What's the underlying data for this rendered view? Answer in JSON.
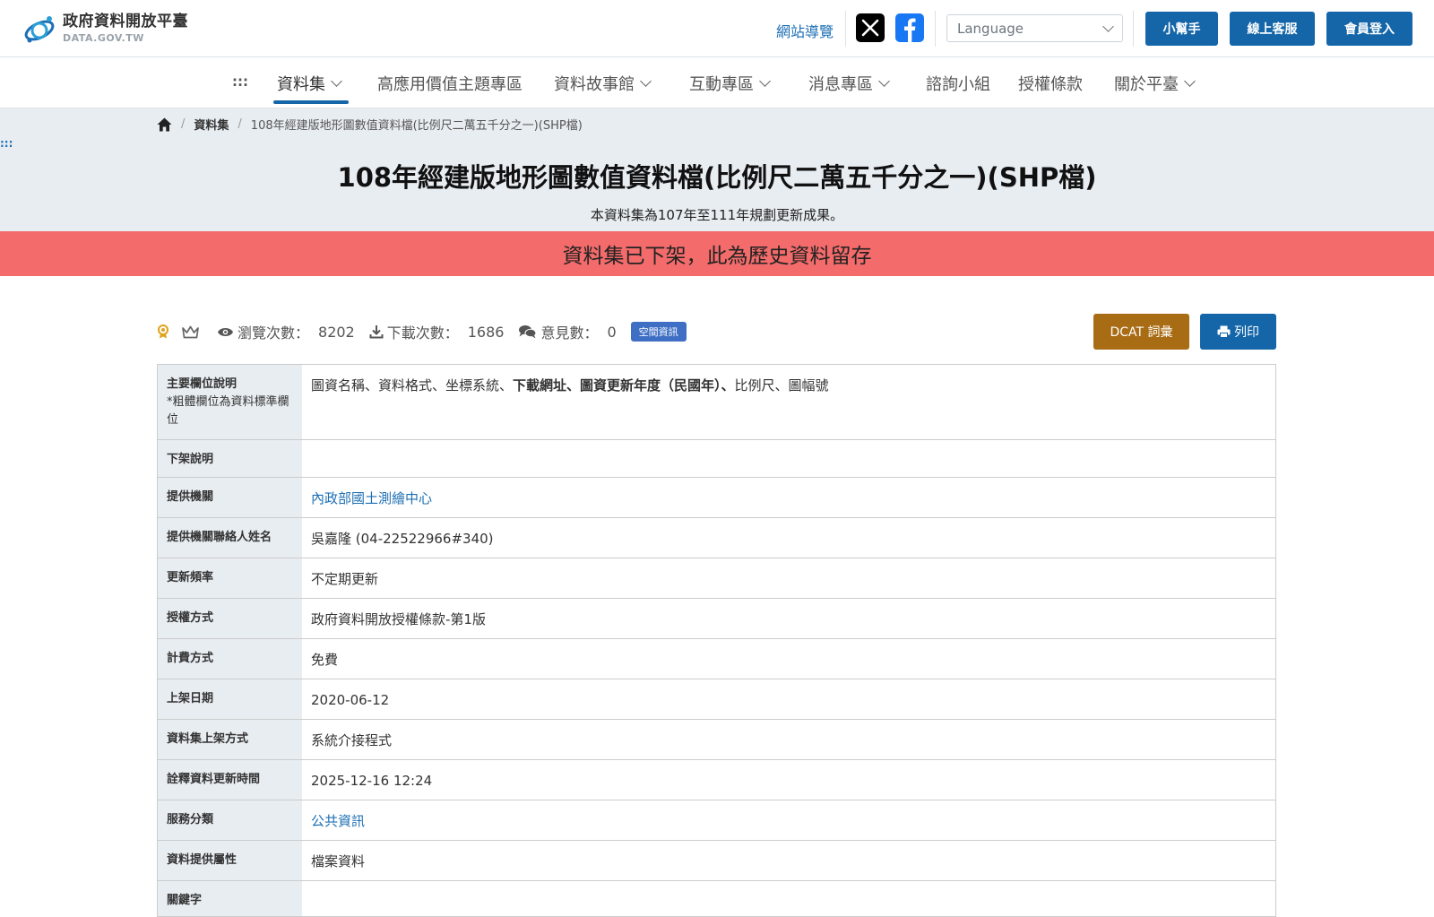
{
  "header": {
    "logo_title": "政府資料開放平臺",
    "logo_sub": "DATA.GOV.TW",
    "sitemap": "網站導覽",
    "language_placeholder": "Language",
    "buttons": {
      "helper": "小幫手",
      "service": "線上客服",
      "login": "會員登入"
    }
  },
  "nav": {
    "accesskey": ":::",
    "items": [
      "資料集",
      "高應用價值主題專區",
      "資料故事館",
      "互動專區",
      "消息專區",
      "諮詢小組",
      "授權條款",
      "關於平臺"
    ]
  },
  "breadcrumb": {
    "level1": "資料集",
    "current": "108年經建版地形圖數值資料檔(比例尺二萬五千分之一)(SHP檔)"
  },
  "hero": {
    "accesskey": ":::",
    "title": "108年經建版地形圖數值資料檔(比例尺二萬五千分之一)(SHP檔)",
    "description": "本資料集為107年至111年規劃更新成果。",
    "notice": "資料集已下架，此為歷史資料留存"
  },
  "stats": {
    "views_label": "瀏覽次數：",
    "views": "8202",
    "downloads_label": "下載次數：",
    "downloads": "1686",
    "comments_label": "意見數：",
    "comments": "0",
    "tag": "空間資訊",
    "dcat_button": "DCAT 詞彙",
    "print_button": "列印"
  },
  "details": {
    "fields_label": "主要欄位說明",
    "fields_note": "*粗體欄位為資料標準欄位",
    "fields_value_a": "圖資名稱、資料格式、坐標系統、",
    "fields_value_bold": "下載網址、圖資更新年度（民國年）、",
    "fields_value_b": "比例尺、圖幅號",
    "delist_label": "下架說明",
    "delist_value": "",
    "provider_label": "提供機關",
    "provider_value": "內政部國土測繪中心",
    "contact_label": "提供機關聯絡人姓名",
    "contact_value": "吳嘉隆 (04-22522966#340)",
    "frequency_label": "更新頻率",
    "frequency_value": "不定期更新",
    "license_label": "授權方式",
    "license_value": "政府資料開放授權條款-第1版",
    "fee_label": "計費方式",
    "fee_value": "免費",
    "published_label": "上架日期",
    "published_value": "2020-06-12",
    "method_label": "資料集上架方式",
    "method_value": "系統介接程式",
    "metadata_updated_label": "詮釋資料更新時間",
    "metadata_updated_value": "2025-12-16 12:24",
    "category_label": "服務分類",
    "category_value": "公共資訊",
    "attribute_label": "資料提供屬性",
    "attribute_value": "檔案資料",
    "keyword_label": "關鍵字"
  },
  "colors": {
    "primary": "#1466a9",
    "notice": "#f36b6b",
    "dcat": "#a86c14",
    "tag": "#3f6fc5",
    "label_bg": "#e8edf2"
  }
}
